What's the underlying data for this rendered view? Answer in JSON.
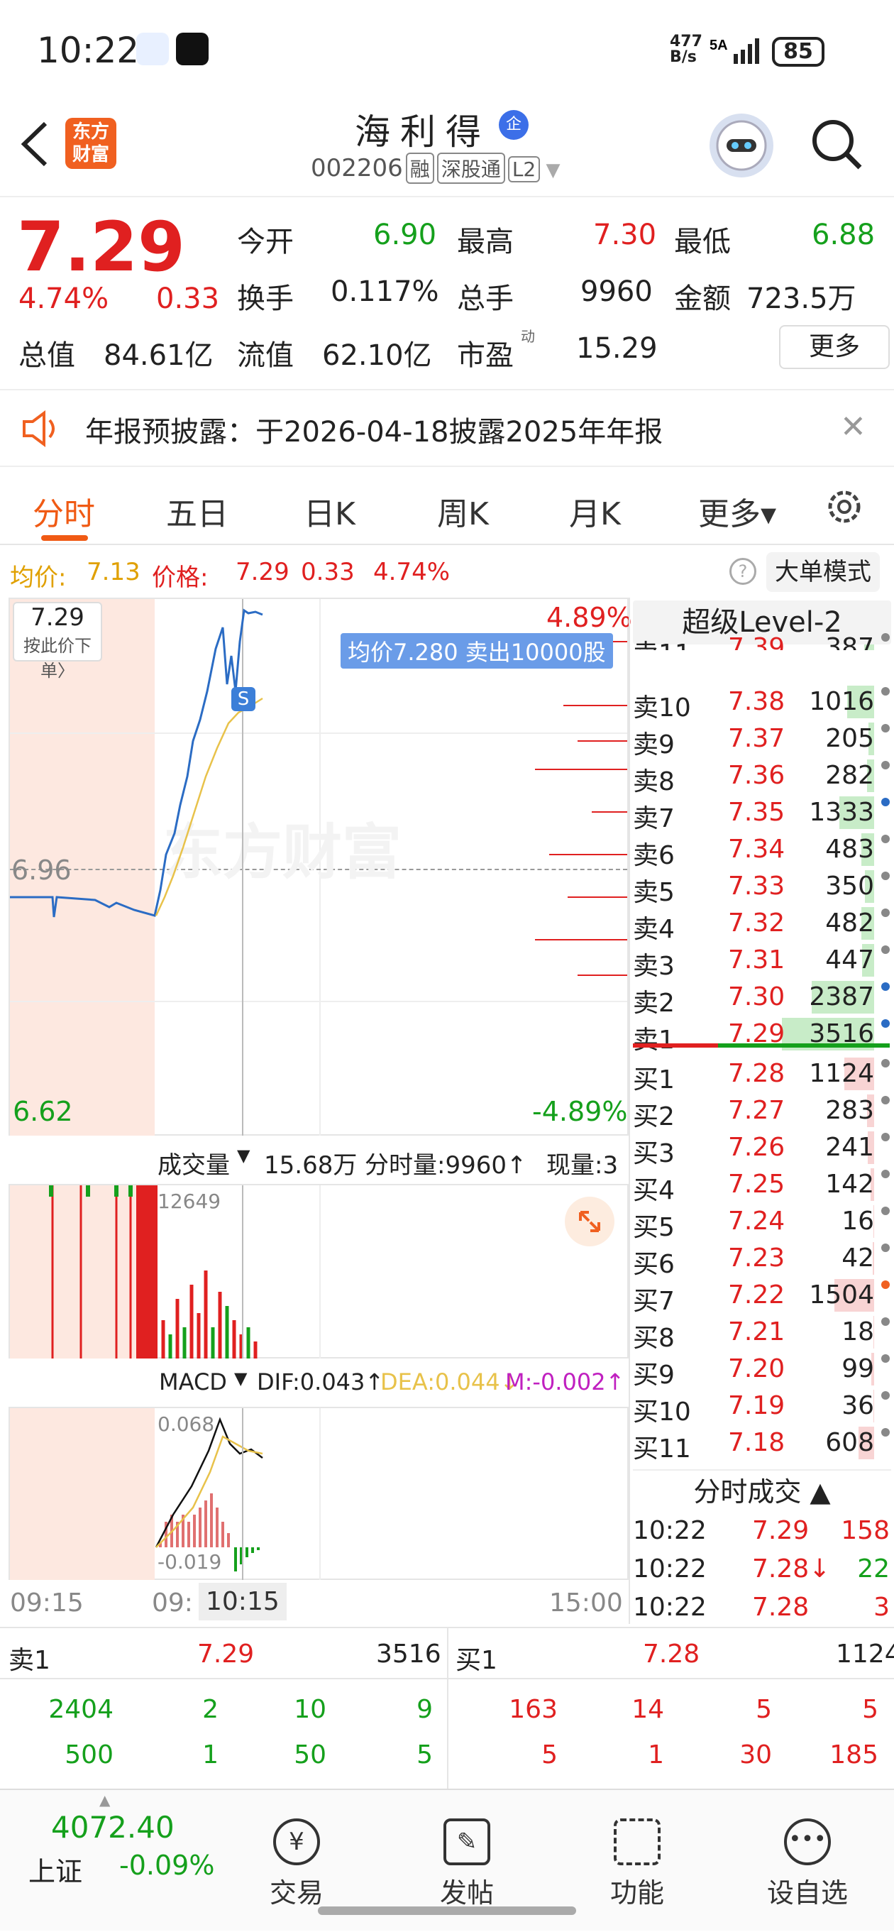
{
  "status": {
    "time": "10:22",
    "net": "477\nB/s",
    "battery": "85"
  },
  "header": {
    "logo": "东方\n财富",
    "name": "海利得",
    "badge": "企",
    "code": "002206",
    "tags": [
      "融",
      "深股通",
      "L2"
    ]
  },
  "quote": {
    "price": "7.29",
    "pct": "4.74%",
    "chg": "0.33",
    "rows": [
      [
        {
          "l": "今开",
          "v": "6.90",
          "c": "green"
        },
        {
          "l": "最高",
          "v": "7.30",
          "c": "red"
        },
        {
          "l": "最低",
          "v": "6.88",
          "c": "green"
        }
      ],
      [
        {
          "l": "换手",
          "v": "0.117%",
          "c": ""
        },
        {
          "l": "总手",
          "v": "9960",
          "c": ""
        },
        {
          "l": "金额",
          "v": "723.5万",
          "c": ""
        }
      ],
      [
        {
          "l": "总值",
          "v": "84.61亿",
          "c": ""
        },
        {
          "l": "流值",
          "v": "62.10亿",
          "c": ""
        },
        {
          "l": "市盈",
          "v": "15.29",
          "c": ""
        }
      ]
    ],
    "pe_sup": "动",
    "more": "更多"
  },
  "notice": {
    "text": "年报预披露：于2026-04-18披露2025年年报"
  },
  "tabs": [
    "分时",
    "五日",
    "日K",
    "周K",
    "月K",
    "更多▾"
  ],
  "info": {
    "avg_label": "均价:",
    "avg": "7.13",
    "price_label": "价格:",
    "price": "7.29",
    "chg": "0.33",
    "pct": "4.74%",
    "mode": "大单模式"
  },
  "chart": {
    "price_box": "7.29",
    "price_box_sub": "按此价下单〉",
    "top_pct": "4.89%",
    "bot_pct": "-4.89%",
    "mid": "6.96",
    "low": "6.62",
    "tip": "均价7.280  卖出10000股",
    "watermark": "东方财富",
    "vol_label": "成交量",
    "vol_total": "15.68万",
    "vol_bar": "分时量:9960↑",
    "vol_now": "现量:3",
    "vol_max": "12649",
    "macd_label": "MACD",
    "dif": "DIF:0.043↑",
    "dea": "DEA:0.044↓",
    "m": "M:-0.002↑",
    "macd_max": "0.068",
    "macd_min": "-0.019",
    "x_start": "09:15",
    "x_mid": "09:",
    "x_cursor": "10:15",
    "x_end": "15:00"
  },
  "level2": {
    "title": "超级Level-2",
    "asks": [
      [
        "卖11",
        "7.39",
        "387"
      ],
      [
        "卖10",
        "7.38",
        "1016"
      ],
      [
        "卖9",
        "7.37",
        "205"
      ],
      [
        "卖8",
        "7.36",
        "282"
      ],
      [
        "卖7",
        "7.35",
        "1333"
      ],
      [
        "卖6",
        "7.34",
        "483"
      ],
      [
        "卖5",
        "7.33",
        "350"
      ],
      [
        "卖4",
        "7.32",
        "482"
      ],
      [
        "卖3",
        "7.31",
        "447"
      ],
      [
        "卖2",
        "7.30",
        "2387"
      ],
      [
        "卖1",
        "7.29",
        "3516"
      ]
    ],
    "bids": [
      [
        "买1",
        "7.28",
        "1124"
      ],
      [
        "买2",
        "7.27",
        "283"
      ],
      [
        "买3",
        "7.26",
        "241"
      ],
      [
        "买4",
        "7.25",
        "142"
      ],
      [
        "买5",
        "7.24",
        "16"
      ],
      [
        "买6",
        "7.23",
        "42"
      ],
      [
        "买7",
        "7.22",
        "1504"
      ],
      [
        "买8",
        "7.21",
        "18"
      ],
      [
        "买9",
        "7.20",
        "99"
      ],
      [
        "买10",
        "7.19",
        "36"
      ],
      [
        "买11",
        "7.18",
        "608"
      ]
    ],
    "trades_title": "分时成交 ▲",
    "trades": [
      [
        "10:22",
        "7.29",
        "158",
        "red"
      ],
      [
        "10:22",
        "7.28↓",
        "22",
        "green"
      ],
      [
        "10:22",
        "7.28",
        "3",
        "red"
      ]
    ]
  },
  "queue": {
    "sell_label": "卖1",
    "sell_price": "7.29",
    "sell_vol": "3516",
    "buy_label": "买1",
    "buy_price": "7.28",
    "buy_vol": "1124",
    "sell_rows": [
      [
        "2404",
        "2",
        "10",
        "9"
      ],
      [
        "500",
        "1",
        "50",
        "5"
      ]
    ],
    "buy_rows": [
      [
        "163",
        "14",
        "5",
        "5"
      ],
      [
        "5",
        "1",
        "30",
        "185"
      ]
    ]
  },
  "bottom": {
    "index": "4072.40",
    "index_name": "上证",
    "index_pct": "-0.09%",
    "nav": [
      "交易",
      "发帖",
      "功能",
      "设自选"
    ]
  }
}
